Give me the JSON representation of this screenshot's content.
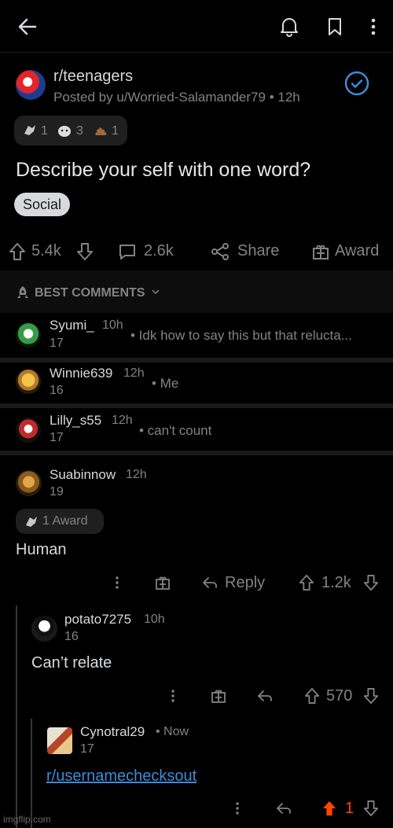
{
  "colors": {
    "accent": "#3d8bd9",
    "upvote": "#ff4500",
    "link": "#3d8bd9"
  },
  "topbar": {
    "icons": [
      "back-icon",
      "bell-icon",
      "bookmark-icon",
      "more-icon"
    ]
  },
  "post": {
    "subreddit": "r/teenagers",
    "posted_by": "Posted by u/Worried-Salamander79",
    "age": "12h",
    "awards": [
      "1",
      "3",
      "1"
    ],
    "title": "Describe your self with one word?",
    "flair": "Social",
    "score": "5.4k",
    "comments": "2.6k",
    "share": "Share",
    "award": "Award"
  },
  "sort": {
    "label": "BEST COMMENTS"
  },
  "collapsed_comments": [
    {
      "user": "Syumi_",
      "age": "10h",
      "score": "17",
      "preview": "• Idk how to say this but that relucta..."
    },
    {
      "user": "Winnie639",
      "age": "12h",
      "score": "16",
      "preview": "• Me"
    },
    {
      "user": "Lilly_s55",
      "age": "12h",
      "score": "17",
      "preview": "• can't count"
    }
  ],
  "comment": {
    "user": "Suabinnow",
    "age": "12h",
    "score": "19",
    "award_label": "1 Award",
    "body": "Human",
    "reply": "Reply",
    "votes": "1.2k"
  },
  "reply1": {
    "user": "potato7275",
    "age": "10h",
    "score": "16",
    "body": "Can’t relate",
    "votes": "570"
  },
  "reply2": {
    "user": "Cynotral29",
    "age": "• Now",
    "score": "17",
    "body": "r/usernamechecksout",
    "votes": "1"
  },
  "watermark": "imgflip.com"
}
